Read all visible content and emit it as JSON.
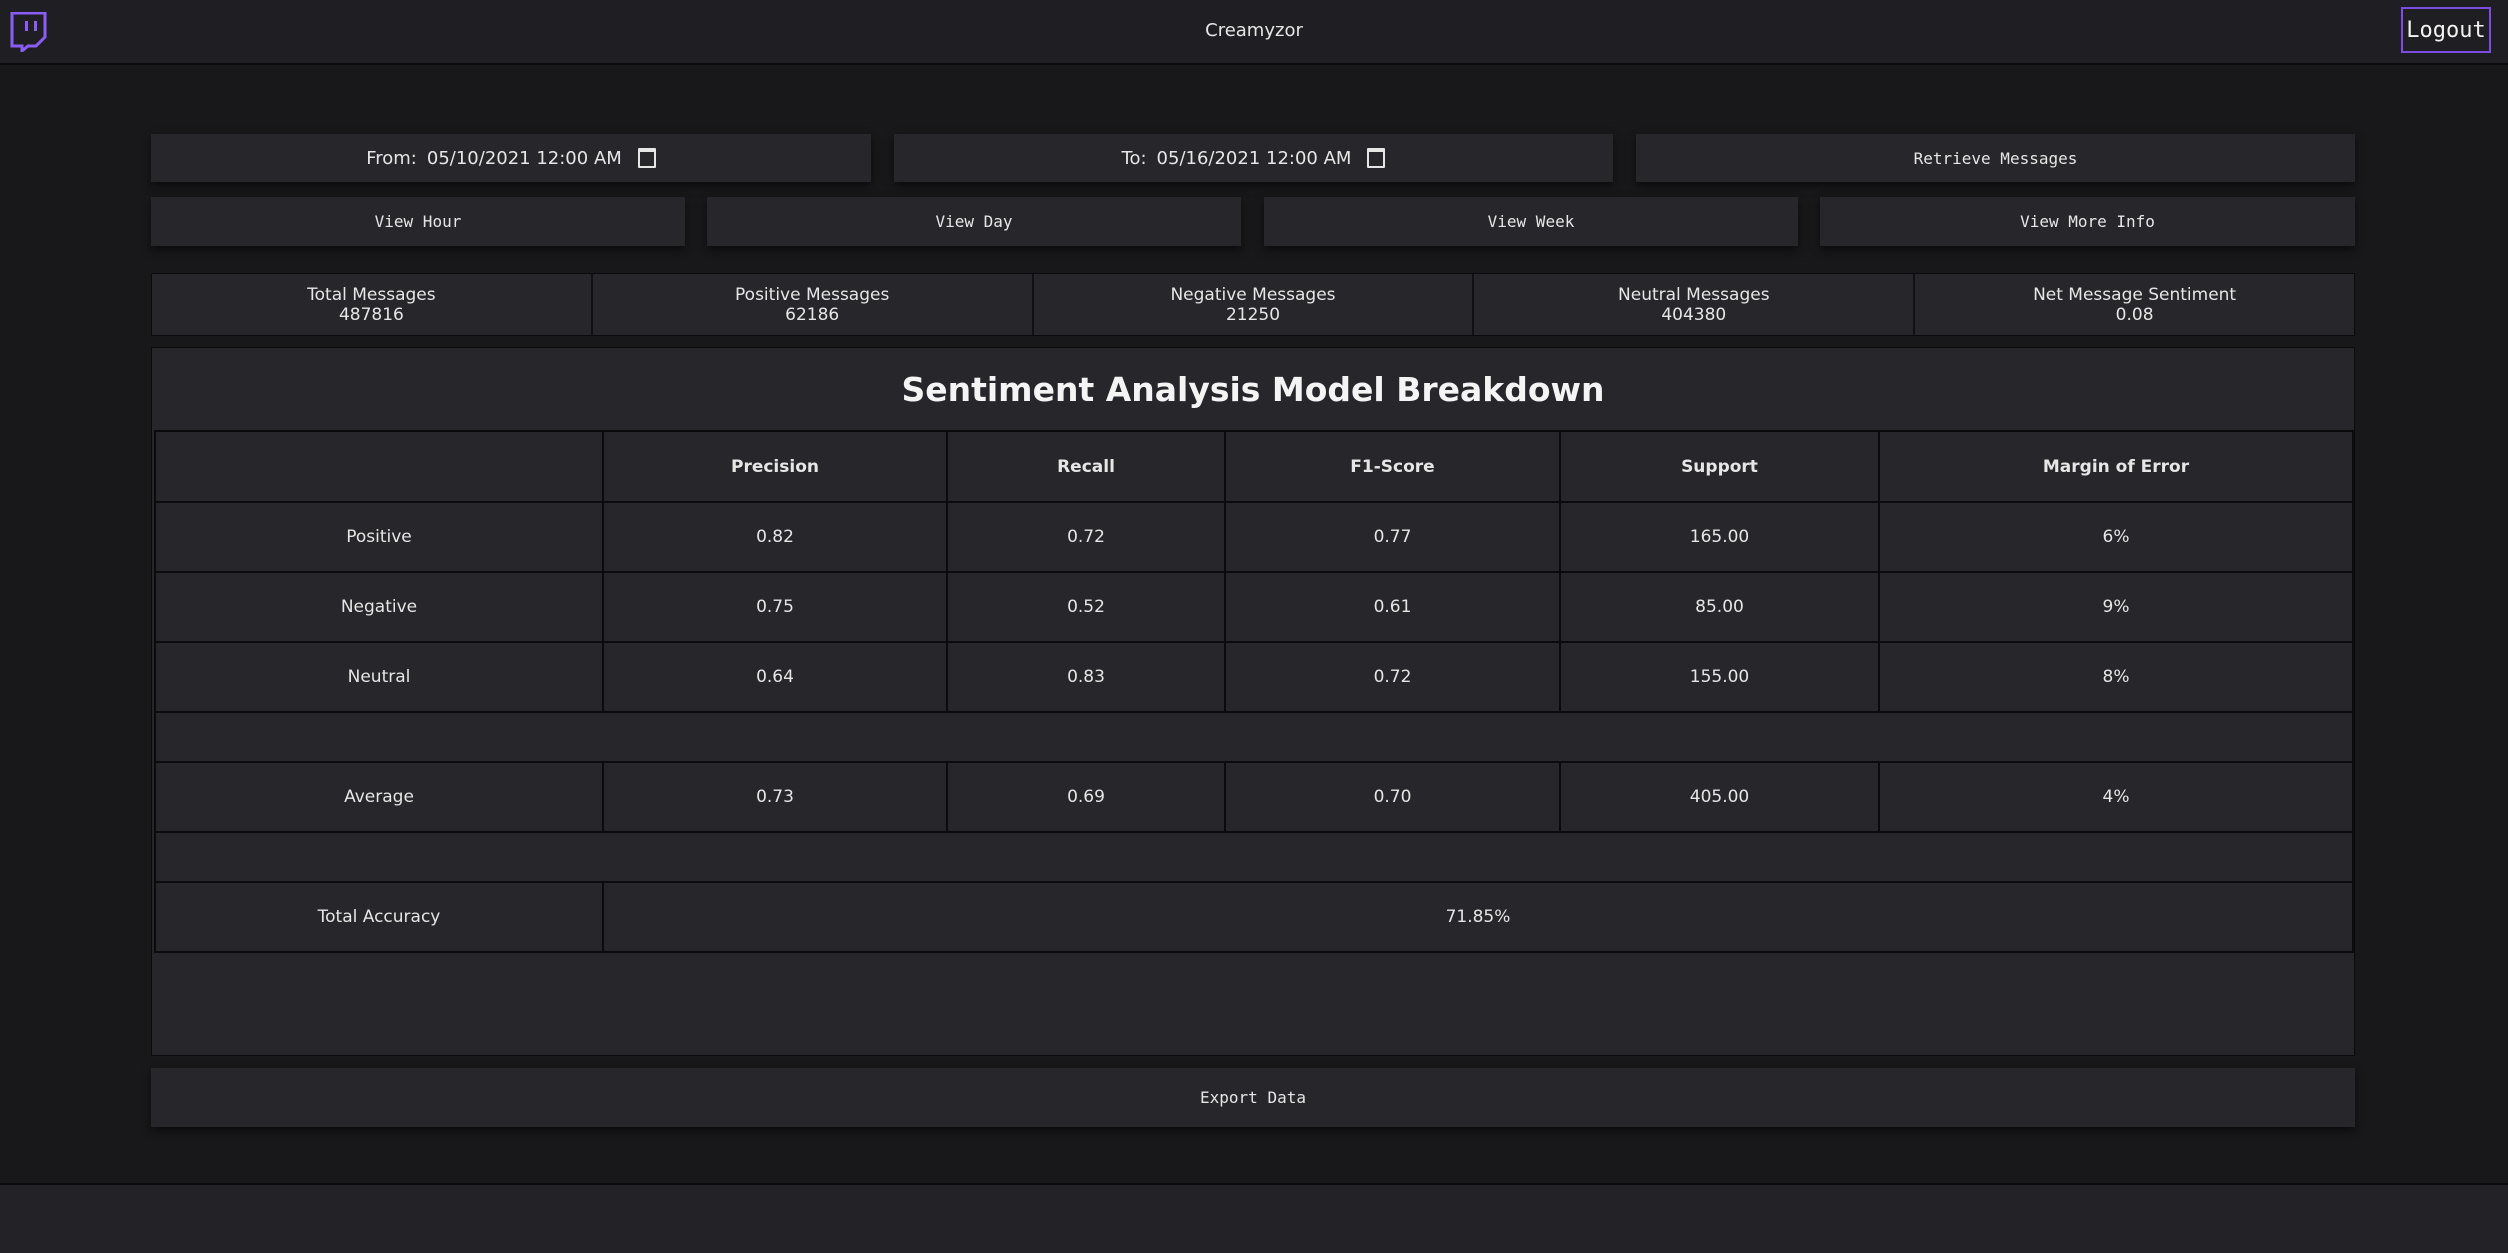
{
  "header": {
    "username": "Creamyzor",
    "logout_label": "Logout"
  },
  "colors": {
    "accent": "#7d4ce0",
    "background": "#18181b",
    "panel": "#26262b"
  },
  "date_range": {
    "from_label": "From:",
    "from_value": "05/10/2021 12:00  AM",
    "to_label": "To:",
    "to_value": "05/16/2021 12:00  AM"
  },
  "buttons": {
    "retrieve": "Retrieve Messages",
    "view_hour": "View Hour",
    "view_day": "View Day",
    "view_week": "View Week",
    "view_more": "View More Info",
    "export": "Export Data"
  },
  "stats": [
    {
      "label": "Total Messages",
      "value": "487816"
    },
    {
      "label": "Positive Messages",
      "value": "62186"
    },
    {
      "label": "Negative Messages",
      "value": "21250"
    },
    {
      "label": "Neutral Messages",
      "value": "404380"
    },
    {
      "label": "Net Message Sentiment",
      "value": "0.08"
    }
  ],
  "breakdown": {
    "title": "Sentiment Analysis Model Breakdown",
    "columns": [
      "",
      "Precision",
      "Recall",
      "F1-Score",
      "Support",
      "Margin of Error"
    ],
    "rows": [
      [
        "Positive",
        "0.82",
        "0.72",
        "0.77",
        "165.00",
        "6%"
      ],
      [
        "Negative",
        "0.75",
        "0.52",
        "0.61",
        "85.00",
        "9%"
      ],
      [
        "Neutral",
        "0.64",
        "0.83",
        "0.72",
        "155.00",
        "8%"
      ]
    ],
    "average": [
      "Average",
      "0.73",
      "0.69",
      "0.70",
      "405.00",
      "4%"
    ],
    "total_accuracy_label": "Total Accuracy",
    "total_accuracy_value": "71.85%"
  }
}
